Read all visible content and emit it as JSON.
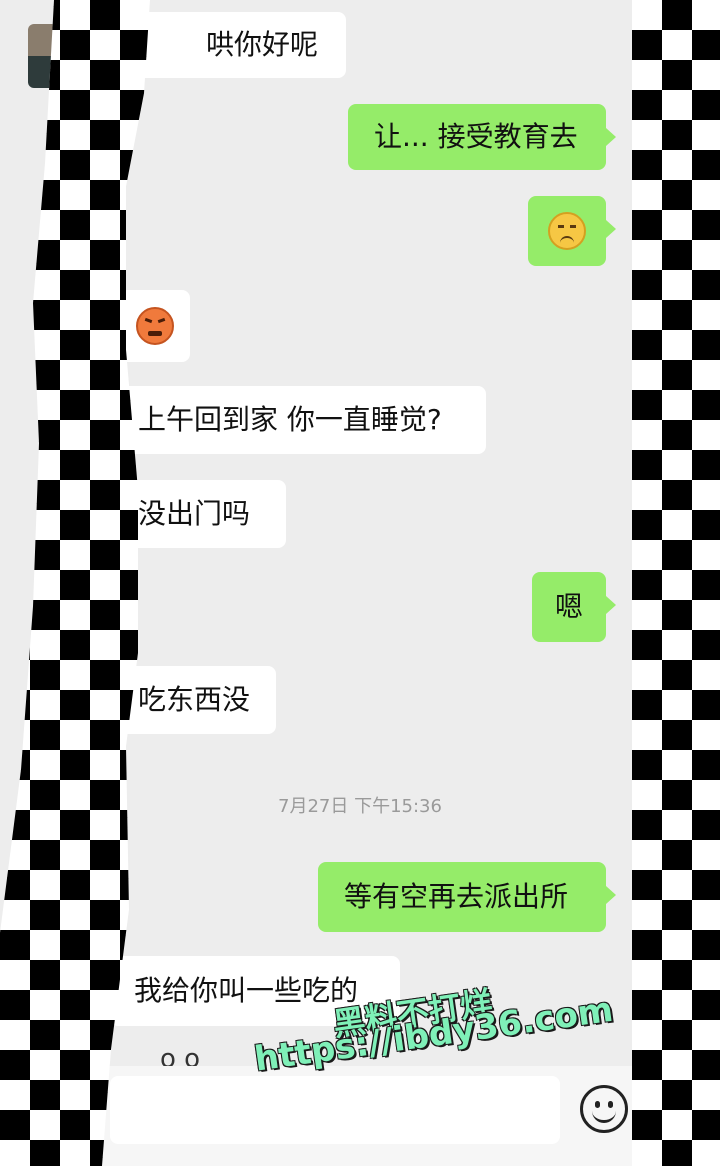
{
  "messages": [
    {
      "text": "哄你好呢",
      "side": "in"
    },
    {
      "text": "让... 接受教育去",
      "side": "out"
    },
    {
      "emoji": "worried-face-emoji",
      "side": "out"
    },
    {
      "emoji": "angry-face-emoji",
      "side": "in"
    },
    {
      "text": "上午回到家 你一直睡觉?",
      "side": "in"
    },
    {
      "text": "没出门吗",
      "side": "in"
    },
    {
      "text": "嗯",
      "side": "out"
    },
    {
      "text": "吃东西没",
      "side": "in"
    },
    {
      "text": "等有空再去派出所",
      "side": "out"
    },
    {
      "text": "我给你叫一些吃的",
      "side": "in"
    }
  ],
  "timestamp": "7月27日 下午15:36",
  "partial_text": "ο ο",
  "watermark": {
    "line1": "黑料不打烊",
    "line2": "https://ibdy36.com"
  },
  "input_bar": {
    "emoji_button_icon": "smiley-icon"
  },
  "colors": {
    "background": "#ededed",
    "incoming_bubble": "#ffffff",
    "outgoing_bubble": "#95ec69",
    "watermark": "#7ff0b8"
  }
}
